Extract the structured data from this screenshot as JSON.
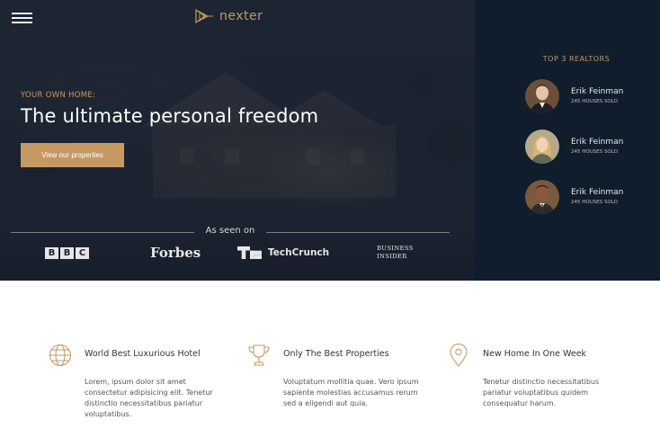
{
  "brand": {
    "name": "nexter",
    "accent": "#c69963",
    "dark_panel": "#101d2c"
  },
  "nav": {
    "menu_icon": "hamburger-menu-icon",
    "logo_icon": "play-triangles-logo-icon"
  },
  "hero": {
    "eyebrow": "YOUR OWN HOME:",
    "headline": "The ultimate personal freedom",
    "cta_label": "View our properties"
  },
  "seen_on": {
    "label": "As seen on",
    "logos": [
      "BBC",
      "Forbes",
      "TechCrunch",
      "BUSINESS INSIDER"
    ]
  },
  "realtors": {
    "title": "TOP 3 REALTORS",
    "items": [
      {
        "name": "Erik Feinman",
        "sold": "245 HOUSES SOLD"
      },
      {
        "name": "Erik Feinman",
        "sold": "245 HOUSES SOLD"
      },
      {
        "name": "Erik Feinman",
        "sold": "245 HOUSES SOLD"
      }
    ]
  },
  "features": [
    {
      "icon": "globe-icon",
      "title": "World Best Luxurious Hotel",
      "text": "Lorem, ipsum dolor sit amet consectetur adipisicing elit. Tenetur distinctio necessitatibus pariatur voluptatibus."
    },
    {
      "icon": "trophy-icon",
      "title": "Only The Best Properties",
      "text": "Voluptatum mollitia quae. Vero ipsum sapiente molestias accusamus rerum sed a eligendi aut quia."
    },
    {
      "icon": "map-pin-icon",
      "title": "New Home In One Week",
      "text": "Tenetur distinctio necessitatibus pariatur voluptatibus quidem consequatur harum."
    }
  ]
}
